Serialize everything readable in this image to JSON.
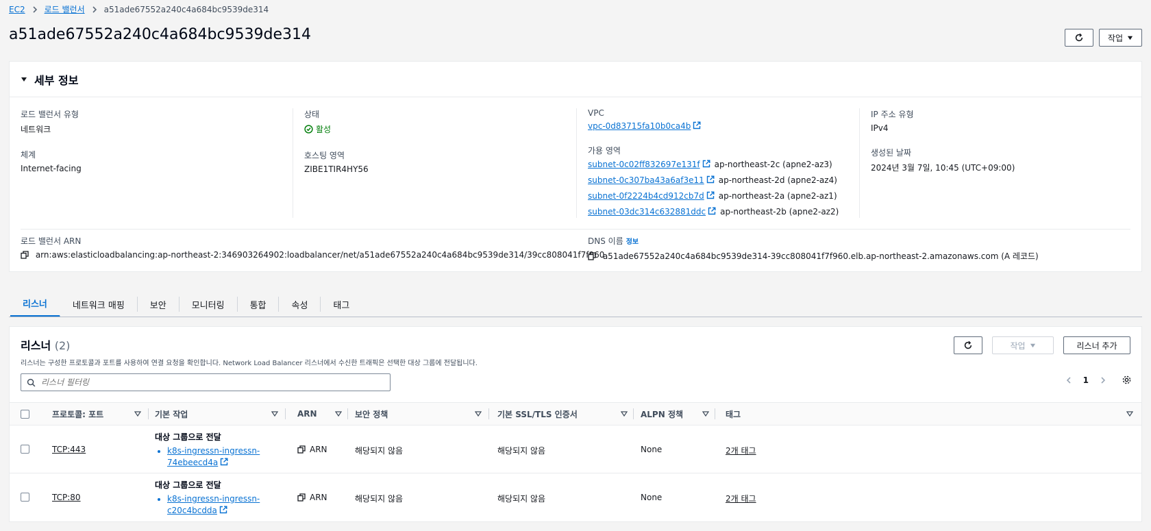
{
  "breadcrumb": {
    "ec2": "EC2",
    "lb": "로드 밸런서",
    "current": "a51ade67552a240c4a684bc9539de314"
  },
  "page_title": "a51ade67552a240c4a684bc9539de314",
  "header_actions": {
    "actions_label": "작업"
  },
  "details": {
    "heading": "세부 정보",
    "lb_type_label": "로드 밸런서 유형",
    "lb_type_value": "네트워크",
    "scheme_label": "체계",
    "scheme_value": "Internet-facing",
    "status_label": "상태",
    "status_value": "활성",
    "hosted_zone_label": "호스팅 영역",
    "hosted_zone_value": "ZIBE1TIR4HY56",
    "vpc_label": "VPC",
    "vpc_value": "vpc-0d83715fa10b0ca4b",
    "az_label": "가용 영역",
    "subnets": [
      {
        "id": "subnet-0c02ff832697e131f",
        "az": "ap-northeast-2c (apne2-az3)"
      },
      {
        "id": "subnet-0c307ba43a6af3e11",
        "az": "ap-northeast-2d (apne2-az4)"
      },
      {
        "id": "subnet-0f2224b4cd912cb7d",
        "az": "ap-northeast-2a (apne2-az1)"
      },
      {
        "id": "subnet-03dc314c632881ddc",
        "az": "ap-northeast-2b (apne2-az2)"
      }
    ],
    "ip_type_label": "IP 주소 유형",
    "ip_type_value": "IPv4",
    "created_label": "생성된 날짜",
    "created_value": "2024년 3월 7일, 10:45 (UTC+09:00)",
    "arn_label": "로드 밸런서 ARN",
    "arn_value": "arn:aws:elasticloadbalancing:ap-northeast-2:346903264902:loadbalancer/net/a51ade67552a240c4a684bc9539de314/39cc808041f7f960",
    "dns_label": "DNS 이름",
    "dns_info": "정보",
    "dns_value": "a51ade67552a240c4a684bc9539de314-39cc808041f7f960.elb.ap-northeast-2.amazonaws.com (A 레코드)"
  },
  "tabs": [
    "리스너",
    "네트워크 매핑",
    "보안",
    "모니터링",
    "통합",
    "속성",
    "태그"
  ],
  "listeners": {
    "title": "리스너",
    "count": "(2)",
    "description": "리스너는 구성한 프로토콜과 포트를 사용하여 연결 요청을 확인합니다. Network Load Balancer 리스너에서 수신한 트래픽은 선택한 대상 그룹에 전달됩니다.",
    "actions_label": "작업",
    "add_label": "리스너 추가",
    "filter_placeholder": "리스너 필터링",
    "page": "1",
    "columns": [
      "프로토콜: 포트",
      "기본 작업",
      "ARN",
      "보안 정책",
      "기본 SSL/TLS 인증서",
      "ALPN 정책",
      "태그"
    ],
    "rows": [
      {
        "protocol": "TCP:443",
        "action_title": "대상 그룹으로 전달",
        "tg_line1": "k8s-ingressn-ingressn-",
        "tg_line2": "74ebeecd4a",
        "arn": "ARN",
        "security_policy": "해당되지 않음",
        "ssl_cert": "해당되지 않음",
        "alpn": "None",
        "tags": "2개 태그"
      },
      {
        "protocol": "TCP:80",
        "action_title": "대상 그룹으로 전달",
        "tg_line1": "k8s-ingressn-ingressn-",
        "tg_line2": "c20c4bcdda",
        "arn": "ARN",
        "security_policy": "해당되지 않음",
        "ssl_cert": "해당되지 않음",
        "alpn": "None",
        "tags": "2개 태그"
      }
    ]
  },
  "colors": {
    "link": "#0972d3",
    "success": "#037f0c",
    "border": "#e9ebed"
  }
}
